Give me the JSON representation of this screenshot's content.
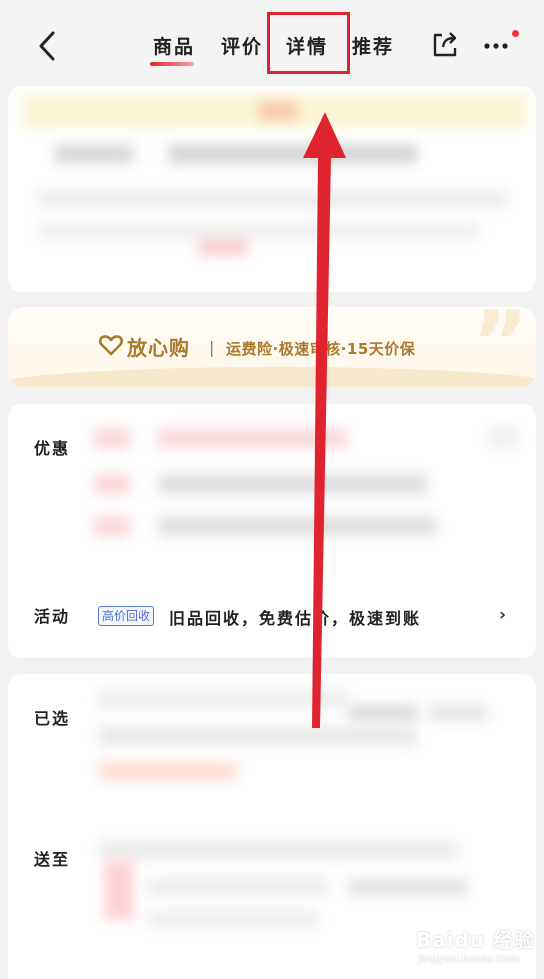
{
  "nav": {
    "tabs": [
      "商品",
      "评价",
      "详情",
      "推荐"
    ],
    "active_tab": "商品",
    "highlighted_tab": "详情"
  },
  "assurance": {
    "title": "放心购",
    "separator": "|",
    "description": "运费险·极速审核·15天价保"
  },
  "promo": {
    "label": "优惠"
  },
  "activity": {
    "label": "活动",
    "badge": "高价回收",
    "text": "旧品回收，免费估价，极速到账"
  },
  "selected": {
    "label": "已选"
  },
  "delivery": {
    "label": "送至"
  },
  "watermark": {
    "brand": "Baidu 经验",
    "url": "jingyan.baidu.com"
  },
  "colors": {
    "accent_red": "#e0242f",
    "gold": "#a97a2c",
    "badge_blue": "#4e6fd0"
  }
}
